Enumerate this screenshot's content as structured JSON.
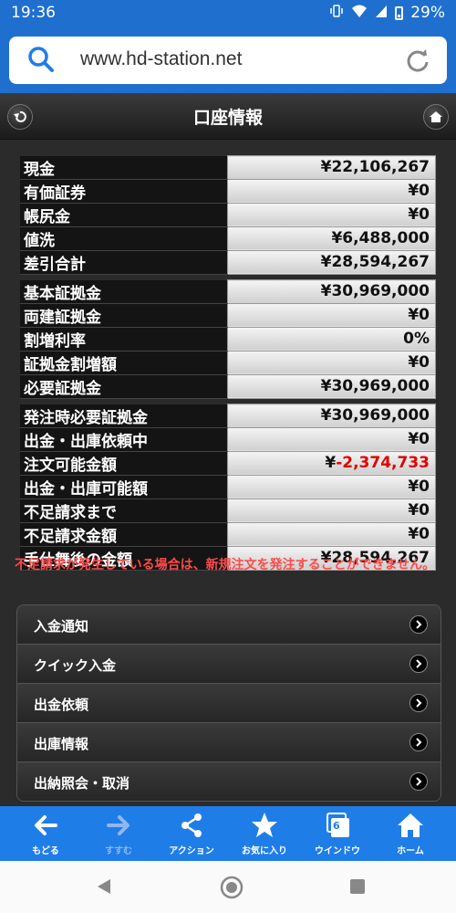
{
  "status_bar": {
    "time": "19:36",
    "battery": "29%"
  },
  "browser": {
    "url": "www.hd-station.net"
  },
  "header": {
    "title": "口座情報"
  },
  "table1": [
    {
      "label": "現金",
      "value": "¥22,106,267"
    },
    {
      "label": "有価証券",
      "value": "¥0"
    },
    {
      "label": "帳尻金",
      "value": "¥0"
    },
    {
      "label": "値洗",
      "value": "¥6,488,000"
    },
    {
      "label": "差引合計",
      "value": "¥28,594,267"
    }
  ],
  "table2": [
    {
      "label": "基本証拠金",
      "value": "¥30,969,000"
    },
    {
      "label": "両建証拠金",
      "value": "¥0"
    },
    {
      "label": "割増利率",
      "value": "0%"
    },
    {
      "label": "証拠金割増額",
      "value": "¥0"
    },
    {
      "label": "必要証拠金",
      "value": "¥30,969,000"
    }
  ],
  "table3": [
    {
      "label": "発注時必要証拠金",
      "value": "¥30,969,000"
    },
    {
      "label": "出金・出庫依頼中",
      "value": "¥0"
    },
    {
      "label": "注文可能金額",
      "value_prefix": "¥",
      "value": "-2,374,733"
    },
    {
      "label": "出金・出庫可能額",
      "value": "¥0"
    },
    {
      "label": "不足請求まで",
      "value": "¥0"
    },
    {
      "label": "不足請求金額",
      "value": "¥0"
    },
    {
      "label": "手仕舞後の金額",
      "value": "¥28,594,267"
    }
  ],
  "warning": "不足請求が発生している場合は、新規注文を発注することができません。",
  "menu": [
    {
      "label": "入金通知"
    },
    {
      "label": "クイック入金"
    },
    {
      "label": "出金依頼"
    },
    {
      "label": "出庫情報"
    },
    {
      "label": "出納照会・取消"
    }
  ],
  "toolbar": {
    "back": "もどる",
    "forward": "すすむ",
    "action": "アクション",
    "favorites": "お気に入り",
    "window": "ウインドウ",
    "window_count": "6",
    "home": "ホーム"
  },
  "colors": {
    "accent": "#1f7de8",
    "negative": "#e00000",
    "warning": "#ff4a4a"
  }
}
